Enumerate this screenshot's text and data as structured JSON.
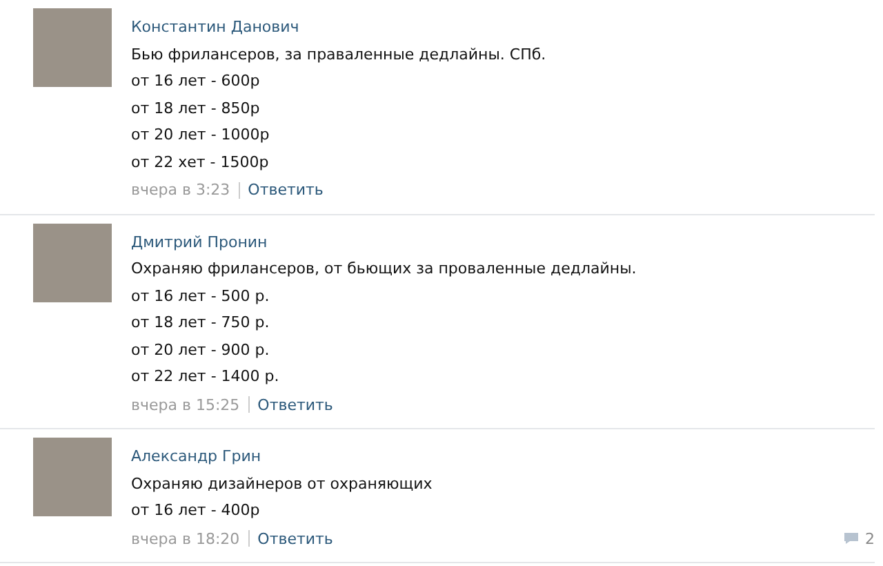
{
  "comments": [
    {
      "author": "Константин Данович",
      "lines": [
        "Бью фрилансеров, за праваленные дедлайны. СПб.",
        "от 16 лет - 600р",
        "от 18 лет - 850р",
        "от 20 лет - 1000р",
        "от 22 хет - 1500р"
      ],
      "time": "вчера в 3:23",
      "reply": "Ответить"
    },
    {
      "author": "Дмитрий Пронин",
      "lines": [
        "Охраняю фрилансеров, от бьющих за проваленные дедлайны.",
        "от 16 лет - 500 р.",
        "от 18 лет - 750 р.",
        "от 20 лет - 900 р.",
        "от 22 лет - 1400 р."
      ],
      "time": "вчера в 15:25",
      "reply": "Ответить"
    },
    {
      "author": "Александр Грин",
      "lines": [
        "Охраняю дизайнеров от охраняющих",
        "от 16 лет - 400р"
      ],
      "time": "вчера в 18:20",
      "reply": "Ответить",
      "count": "2"
    }
  ]
}
